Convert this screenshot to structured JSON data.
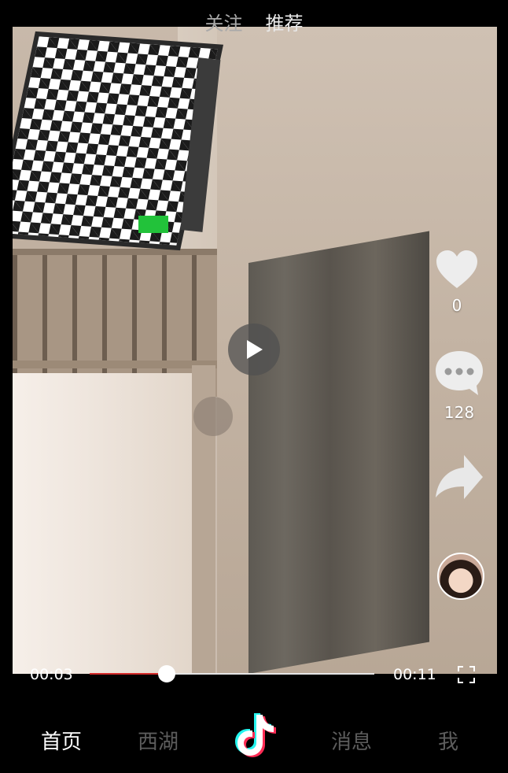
{
  "top_tabs": [
    {
      "label": "关注",
      "active": false
    },
    {
      "label": "推荐",
      "active": true
    }
  ],
  "video": {
    "state": "paused"
  },
  "actions": {
    "like": {
      "icon": "heart-icon",
      "count": "0"
    },
    "comment": {
      "icon": "comment-bubble-icon",
      "count": "128"
    },
    "share": {
      "icon": "share-arrow-icon"
    },
    "avatar": {
      "icon": "user-avatar"
    }
  },
  "progress": {
    "current": "00:03",
    "total": "00:11",
    "fraction": 0.27
  },
  "bottom_nav": [
    {
      "label": "首页",
      "active": true
    },
    {
      "label": "西湖",
      "active": false
    },
    {
      "label": "",
      "icon": "tiktok-logo-icon"
    },
    {
      "label": "消息",
      "active": false
    },
    {
      "label": "我",
      "active": false
    }
  ],
  "colors": {
    "accent": "#d42a2a",
    "nav_active": "#ffffff",
    "nav_inactive": "#5d5d5d"
  }
}
